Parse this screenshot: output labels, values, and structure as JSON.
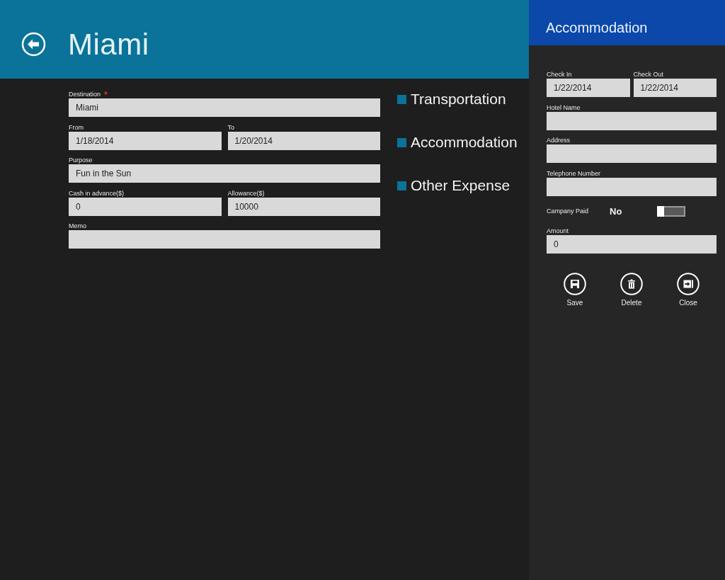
{
  "header": {
    "title": "Miami"
  },
  "form": {
    "rows": [
      {
        "fields": [
          {
            "label": "Destination",
            "value": "Miami",
            "required": true
          }
        ]
      },
      {
        "fields": [
          {
            "label": "From",
            "value": "1/18/2014",
            "required": false
          },
          {
            "label": "To",
            "value": "1/20/2014",
            "required": false
          }
        ]
      },
      {
        "fields": [
          {
            "label": "Purpose",
            "value": "Fun in the Sun",
            "required": false
          }
        ]
      },
      {
        "fields": [
          {
            "label": "Cash in advance($)",
            "value": "0",
            "required": false
          },
          {
            "label": "Allowance($)",
            "value": "10000",
            "required": false
          }
        ]
      },
      {
        "fields": [
          {
            "label": "Memo",
            "required": false
          }
        ]
      }
    ]
  },
  "categories": [
    {
      "label": "Transportation"
    },
    {
      "label": "Accommodation"
    },
    {
      "label": "Other Expense"
    }
  ],
  "panel": {
    "title": "Accommodation",
    "rows": [
      {
        "kind": "fields",
        "fields": [
          {
            "label": "Check In",
            "value": "1/22/2014"
          },
          {
            "label": "Check Out",
            "value": "1/22/2014"
          }
        ]
      },
      {
        "kind": "fields",
        "fields": [
          {
            "label": "Hotel Name"
          }
        ]
      },
      {
        "kind": "fields",
        "fields": [
          {
            "label": "Address"
          }
        ]
      },
      {
        "kind": "fields",
        "fields": [
          {
            "label": "Telephone Number"
          }
        ]
      },
      {
        "kind": "toggle",
        "label": "Campany Paid",
        "state_text": "No",
        "on": false
      },
      {
        "kind": "fields",
        "fields": [
          {
            "label": "Amount",
            "value": "0"
          }
        ]
      }
    ],
    "actions": [
      {
        "kind": "save",
        "label": "Save"
      },
      {
        "kind": "delete",
        "label": "Delete"
      },
      {
        "kind": "close",
        "label": "Close"
      }
    ]
  }
}
